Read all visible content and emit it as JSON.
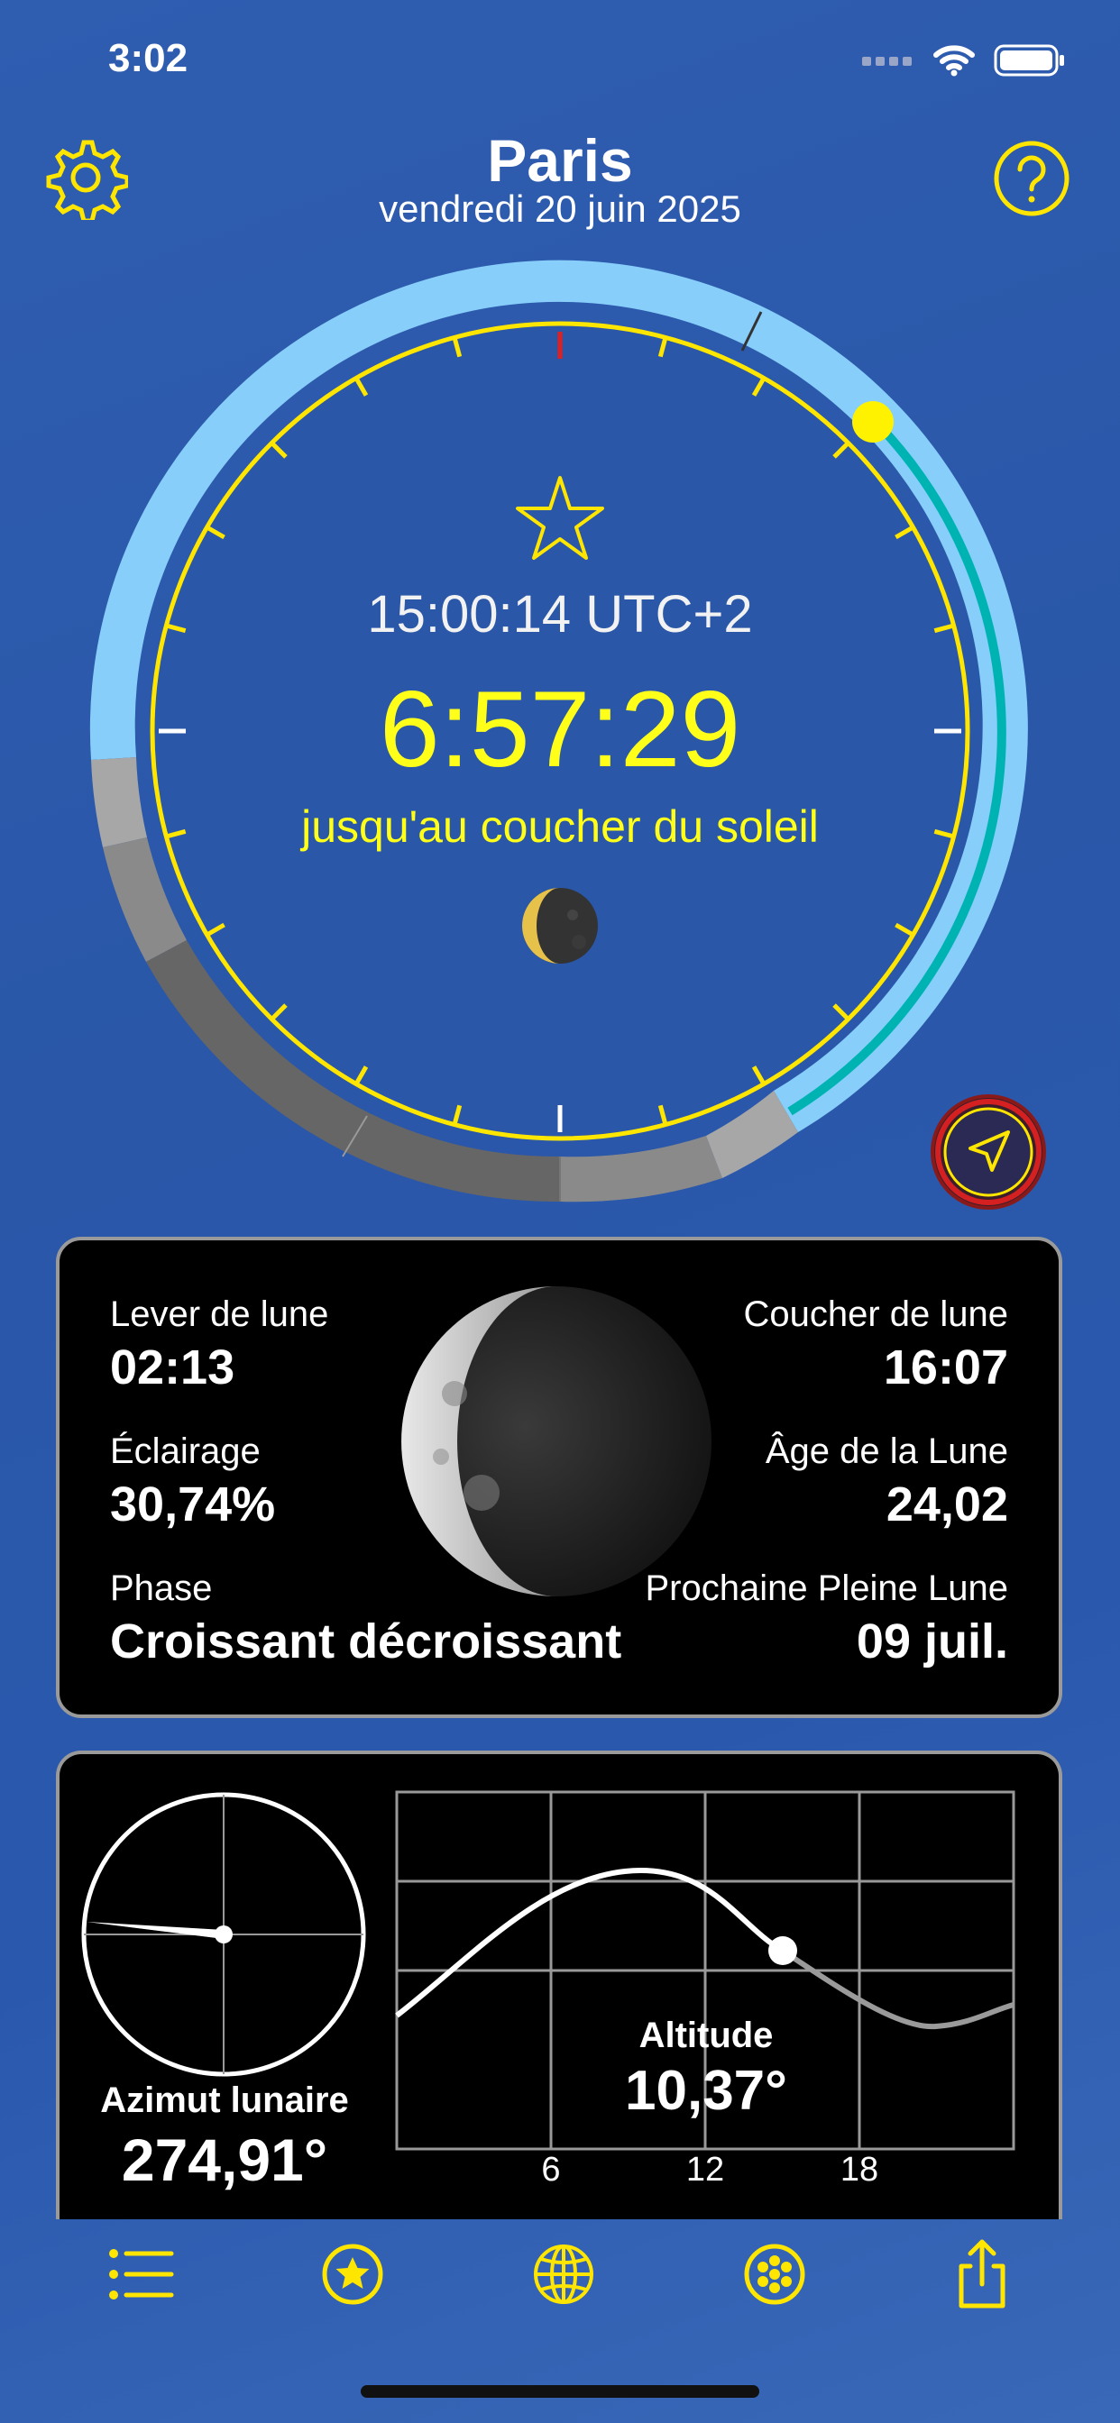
{
  "status": {
    "time": "3:02"
  },
  "header": {
    "city": "Paris",
    "date": "vendredi 20 juin 2025"
  },
  "dial": {
    "current_time": "15:00:14 UTC+2",
    "countdown": "6:57:29",
    "caption": "jusqu'au coucher du soleil"
  },
  "moon": {
    "rise_label": "Lever de lune",
    "rise_value": "02:13",
    "set_label": "Coucher de lune",
    "set_value": "16:07",
    "illum_label": "Éclairage",
    "illum_value": "30,74%",
    "age_label": "Âge de la Lune",
    "age_value": "24,02",
    "phase_label": "Phase",
    "phase_value": "Croissant décroissant",
    "full_label": "Prochaine Pleine Lune",
    "full_value": "09 juil."
  },
  "position": {
    "azimuth_label": "Azimut lunaire",
    "azimuth_value": "274,91°",
    "altitude_label": "Altitude",
    "altitude_value": "10,37°",
    "x_ticks": [
      "6",
      "12",
      "18"
    ]
  },
  "tabs": [
    "list-icon",
    "star-circle-icon",
    "globe-icon",
    "moon-phases-icon",
    "share-icon"
  ],
  "colors": {
    "accent": "#FFE600",
    "sky": "#87CEFA",
    "teal": "#00B3B3",
    "background": "#2B58AA"
  }
}
